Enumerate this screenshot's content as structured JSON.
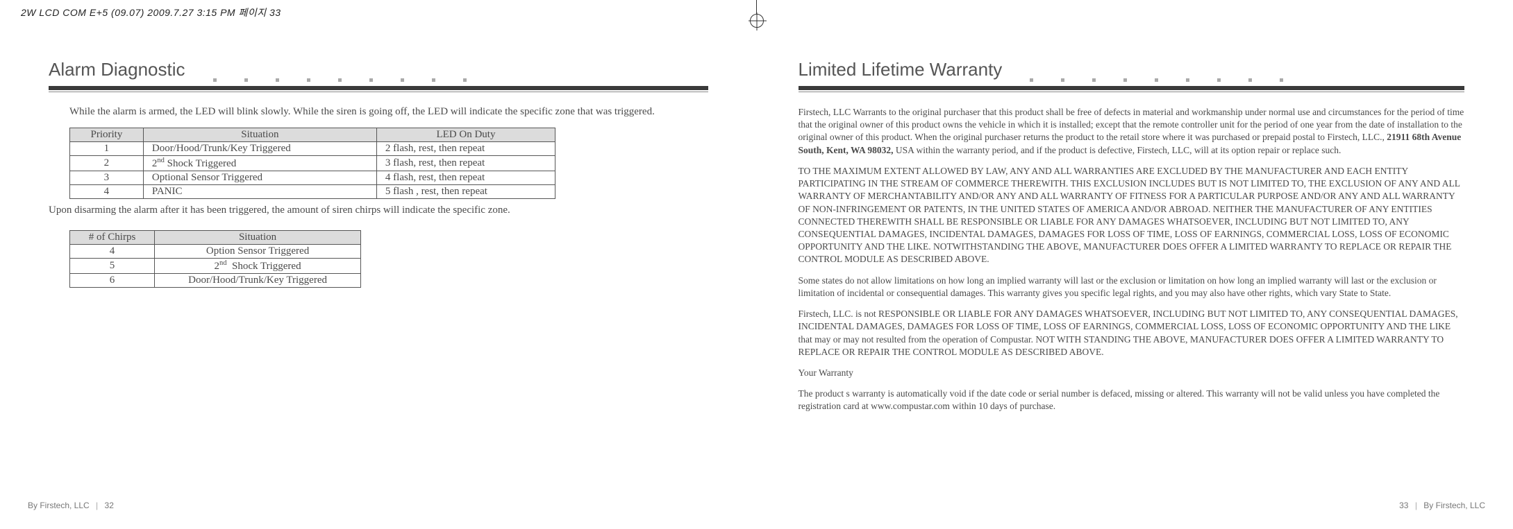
{
  "print_header": "2W LCD COM E+5 (09.07)  2009.7.27 3:15 PM  페이지 33",
  "left": {
    "title": "Alarm Diagnostic",
    "intro": "While the alarm is armed, the LED will blink slowly. While the siren is going off, the LED will indicate the specific zone that was triggered.",
    "table1": {
      "headers": [
        "Priority",
        "Situation",
        "LED On Duty"
      ],
      "rows": [
        [
          "1",
          "Door/Hood/Trunk/Key Triggered",
          "2 flash, rest, then repeat"
        ],
        [
          "2",
          "2nd Shock Triggered",
          "3 flash, rest, then repeat"
        ],
        [
          "3",
          "Optional Sensor Triggered",
          "4 flash, rest, then repeat"
        ],
        [
          "4",
          "PANIC",
          "5 flash , rest, then repeat"
        ]
      ]
    },
    "mid_note": "Upon disarming the alarm after it has been triggered, the amount of siren chirps will indicate the specific zone.",
    "table2": {
      "headers": [
        "# of Chirps",
        "Situation"
      ],
      "rows": [
        [
          "4",
          "Option Sensor Triggered"
        ],
        [
          "5",
          "2nd  Shock Triggered"
        ],
        [
          "6",
          "Door/Hood/Trunk/Key Triggered"
        ]
      ]
    },
    "footer_brand": "By Firstech, LLC",
    "footer_page": "32"
  },
  "right": {
    "title": "Limited Lifetime Warranty",
    "p1a": "Firstech, LLC Warrants to the original purchaser that this product shall be free of defects in material and workmanship under normal use and circumstances for the period of time that the original owner of this product owns the vehicle in which it is installed; except that the remote controller unit for the period of one year from the date of installation to the original owner of this product. When the original purchaser returns the product to the retail store where it was purchased or prepaid postal to Firstech, LLC., ",
    "p1_bold": "21911 68th Avenue South, Kent, WA 98032,",
    "p1b": " USA within the warranty period, and if the product is defective, Firstech, LLC, will at its option repair or replace such.",
    "p2": "TO THE MAXIMUM EXTENT ALLOWED BY LAW, ANY AND ALL WARRANTIES ARE EXCLUDED BY THE MANUFACTURER AND EACH ENTITY PARTICIPATING IN THE STREAM OF COMMERCE THEREWITH. THIS EXCLUSION INCLUDES BUT IS NOT LIMITED TO, THE EXCLUSION OF ANY AND ALL WARRANTY OF MERCHANTABILITY AND/OR ANY AND ALL WARRANTY OF FITNESS FOR A PARTICULAR PURPOSE AND/OR ANY AND ALL WARRANTY OF NON-INFRINGEMENT OR PATENTS, IN THE UNITED STATES OF AMERICA AND/OR ABROAD. NEITHER THE MANUFACTURER OF ANY ENTITIES CONNECTED THEREWITH SHALL BE RESPONSIBLE OR LIABLE FOR ANY DAMAGES WHATSOEVER, INCLUDING BUT NOT LIMITED TO, ANY CONSEQUENTIAL DAMAGES, INCIDENTAL DAMAGES, DAMAGES FOR LOSS OF TIME, LOSS OF EARNINGS, COMMERCIAL LOSS, LOSS OF ECONOMIC OPPORTUNITY AND THE LIKE. NOTWITHSTANDING THE ABOVE, MANUFACTURER DOES OFFER A LIMITED WARRANTY TO REPLACE OR REPAIR THE CONTROL MODULE AS DESCRIBED ABOVE.",
    "p3": "Some states do not allow limitations on how long an implied warranty will last or the exclusion or limitation on how long an implied warranty will last or the exclusion or limitation of incidental or consequential damages. This warranty gives you specific legal rights, and you may also have other rights, which vary State to State.",
    "p4": "Firstech, LLC. is not RESPONSIBLE OR LIABLE FOR ANY DAMAGES WHATSOEVER, INCLUDING BUT NOT LIMITED TO, ANY CONSEQUENTIAL DAMAGES, INCIDENTAL DAMAGES, DAMAGES FOR LOSS OF TIME, LOSS OF EARNINGS, COMMERCIAL LOSS, LOSS OF ECONOMIC OPPORTUNITY AND THE LIKE that may or may not resulted from the operation of Compustar. NOT WITH STANDING THE ABOVE, MANUFACTURER DOES OFFER A LIMITED WARRANTY TO REPLACE OR REPAIR THE CONTROL MODULE AS DESCRIBED ABOVE.",
    "p5": "Your Warranty",
    "p6": "The product s warranty is automatically void if the date code or serial number is defaced, missing or altered. This warranty will not be valid unless you have completed the registration card at www.compustar.com within 10 days of purchase.",
    "footer_page": "33",
    "footer_brand": "By Firstech, LLC"
  }
}
